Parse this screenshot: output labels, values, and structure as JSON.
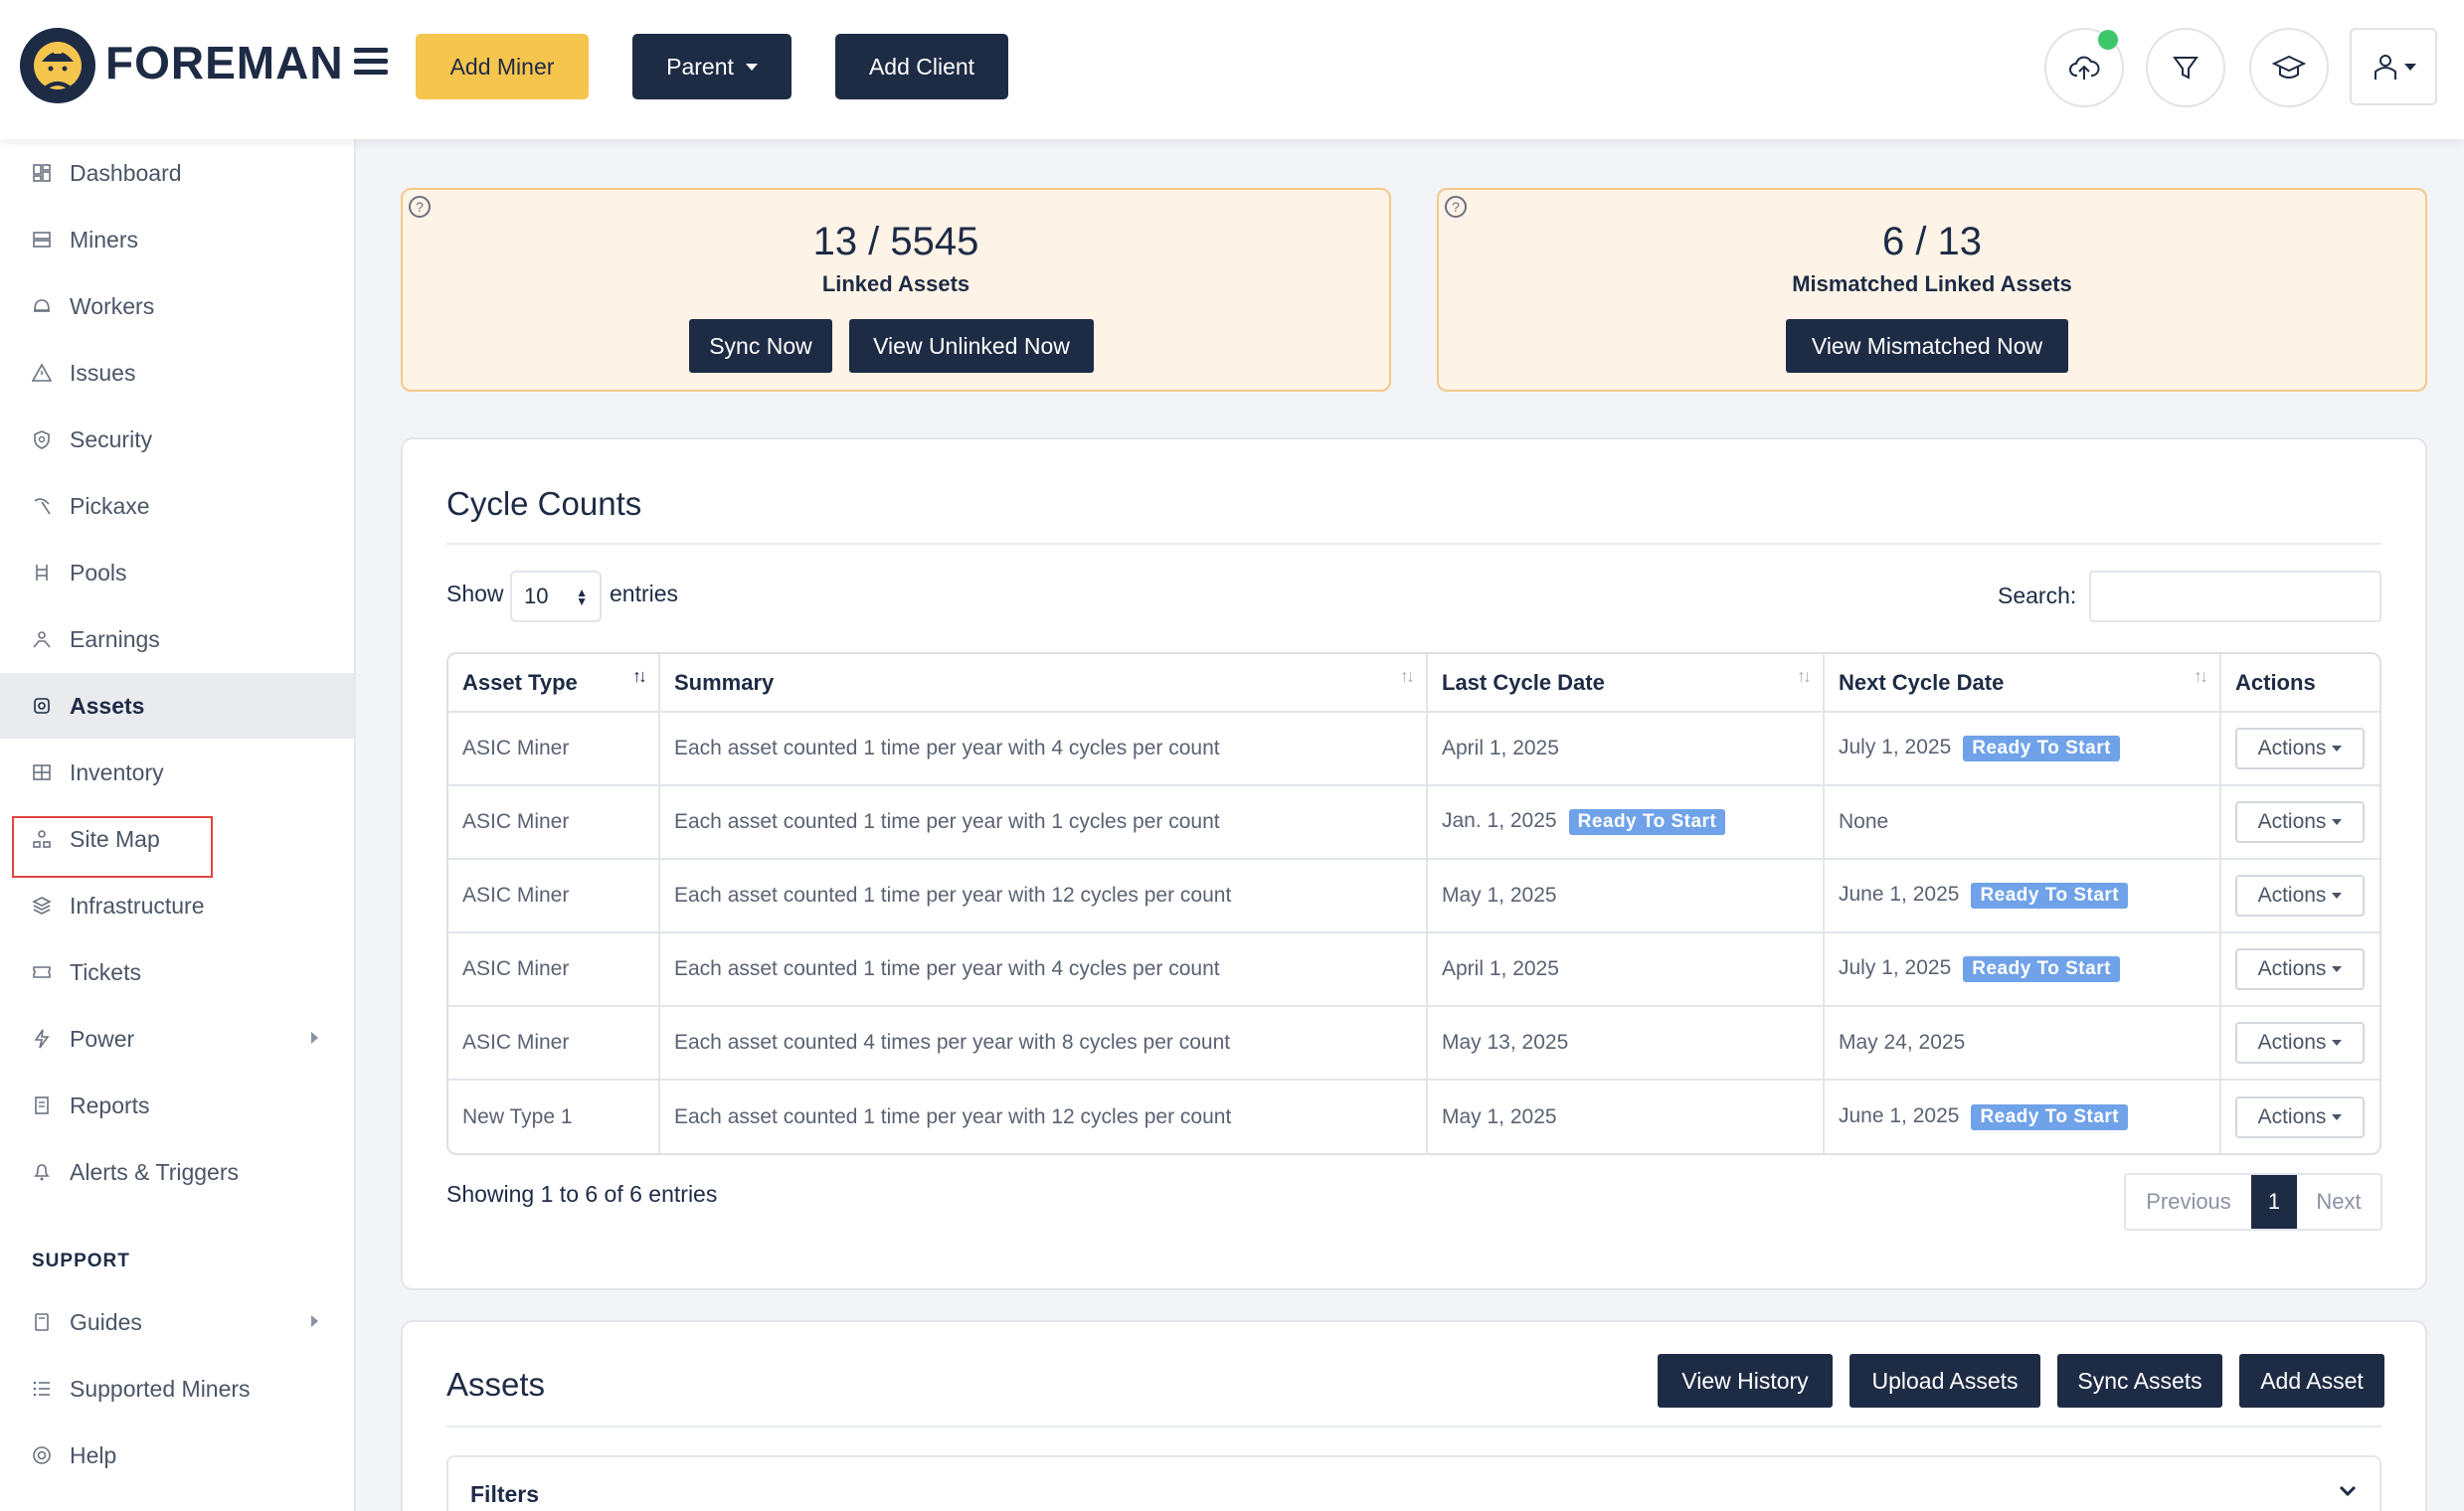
{
  "brand": {
    "name": "FOREMAN"
  },
  "header": {
    "add_miner": "Add Miner",
    "parent": "Parent",
    "add_client": "Add Client",
    "colors": {
      "navy": "#1e2b45",
      "yellow": "#f6c54d",
      "status_dot": "#3ec76a"
    }
  },
  "sidebar": {
    "items": [
      {
        "label": "Dashboard",
        "icon": "dashboard-icon"
      },
      {
        "label": "Miners",
        "icon": "server-icon"
      },
      {
        "label": "Workers",
        "icon": "helmet-icon"
      },
      {
        "label": "Issues",
        "icon": "warning-icon"
      },
      {
        "label": "Security",
        "icon": "shield-icon"
      },
      {
        "label": "Pickaxe",
        "icon": "pickaxe-icon"
      },
      {
        "label": "Pools",
        "icon": "pools-icon"
      },
      {
        "label": "Earnings",
        "icon": "earnings-icon"
      },
      {
        "label": "Assets",
        "icon": "gear-icon"
      },
      {
        "label": "Inventory",
        "icon": "inventory-icon"
      },
      {
        "label": "Site Map",
        "icon": "sitemap-icon"
      },
      {
        "label": "Infrastructure",
        "icon": "layers-icon"
      },
      {
        "label": "Tickets",
        "icon": "ticket-icon"
      },
      {
        "label": "Power",
        "icon": "bolt-icon"
      },
      {
        "label": "Reports",
        "icon": "report-icon"
      },
      {
        "label": "Alerts & Triggers",
        "icon": "bell-icon"
      }
    ],
    "support_title": "SUPPORT",
    "support_items": [
      {
        "label": "Guides",
        "icon": "book-icon"
      },
      {
        "label": "Supported Miners",
        "icon": "list-icon"
      },
      {
        "label": "Help",
        "icon": "lifebuoy-icon"
      }
    ]
  },
  "stats": {
    "linked": {
      "value": "13 / 5545",
      "label": "Linked Assets",
      "sync": "Sync Now",
      "view": "View Unlinked Now"
    },
    "mismatched": {
      "value": "6 / 13",
      "label": "Mismatched Linked Assets",
      "view": "View Mismatched Now"
    }
  },
  "cycle_counts": {
    "title": "Cycle Counts",
    "show": "Show",
    "entries_value": "10",
    "entries": "entries",
    "search_label": "Search:",
    "columns": [
      "Asset Type",
      "Summary",
      "Last Cycle Date",
      "Next Cycle Date",
      "Actions"
    ],
    "rows": [
      {
        "type": "ASIC Miner",
        "summary": "Each asset counted 1 time per year with 4 cycles per count",
        "last": "April 1, 2025",
        "last_badge": "",
        "next": "July 1, 2025",
        "next_badge": "Ready To Start",
        "action": "Actions"
      },
      {
        "type": "ASIC Miner",
        "summary": "Each asset counted 1 time per year with 1 cycles per count",
        "last": "Jan. 1, 2025",
        "last_badge": "Ready To Start",
        "next": "None",
        "next_badge": "",
        "action": "Actions"
      },
      {
        "type": "ASIC Miner",
        "summary": "Each asset counted 1 time per year with 12 cycles per count",
        "last": "May 1, 2025",
        "last_badge": "",
        "next": "June 1, 2025",
        "next_badge": "Ready To Start",
        "action": "Actions"
      },
      {
        "type": "ASIC Miner",
        "summary": "Each asset counted 1 time per year with 4 cycles per count",
        "last": "April 1, 2025",
        "last_badge": "",
        "next": "July 1, 2025",
        "next_badge": "Ready To Start",
        "action": "Actions"
      },
      {
        "type": "ASIC Miner",
        "summary": "Each asset counted 4 times per year with 8 cycles per count",
        "last": "May 13, 2025",
        "last_badge": "",
        "next": "May 24, 2025",
        "next_badge": "",
        "action": "Actions"
      },
      {
        "type": "New Type 1",
        "summary": "Each asset counted 1 time per year with 12 cycles per count",
        "last": "May 1, 2025",
        "last_badge": "",
        "next": "June 1, 2025",
        "next_badge": "Ready To Start",
        "action": "Actions"
      }
    ],
    "info": "Showing 1 to 6 of 6 entries",
    "pager": {
      "prev": "Previous",
      "page": "1",
      "next": "Next"
    },
    "badge_color": "#6fa2e8"
  },
  "assets": {
    "title": "Assets",
    "view_history": "View History",
    "upload": "Upload Assets",
    "sync": "Sync Assets",
    "add": "Add Asset",
    "filters": "Filters"
  }
}
